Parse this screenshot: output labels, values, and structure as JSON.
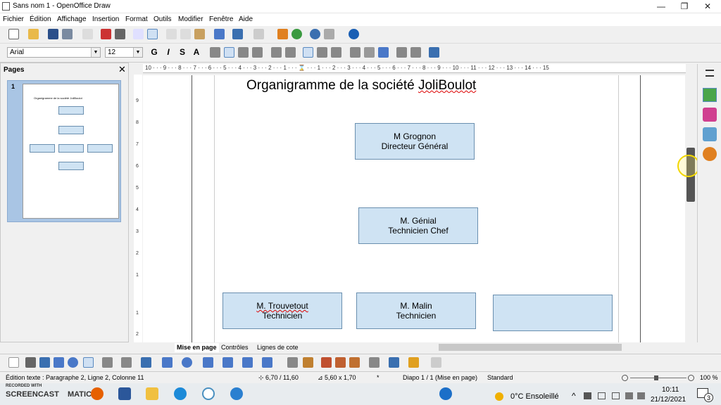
{
  "window": {
    "title": "Sans nom 1 - OpenOffice Draw",
    "minimize": "—",
    "restore": "❐",
    "close": "✕"
  },
  "menu": [
    "Fichier",
    "Édition",
    "Affichage",
    "Insertion",
    "Format",
    "Outils",
    "Modifier",
    "Fenêtre",
    "Aide"
  ],
  "format_bar": {
    "font_name": "Arial",
    "font_size": "12",
    "bold": "G",
    "italic": "I",
    "shadow": "S",
    "outline": "A"
  },
  "pages_panel": {
    "title": "Pages",
    "close": "✕",
    "page_number": "1",
    "thumb_title": "Organigramme de la société JoliBoulot"
  },
  "ruler_h": "10 · · · 9 · · · 8 · · · 7 · · · 6 · · · 5 · · · 4 · · · 3 · · · 2 · · · 1 · · · ⌛ · · · 1 · · · 2 · · · 3 · · · 4 · · · 5 · · · 6 · · · 7 · · · 8 · · · 9 · · · 10 · · · 11 · · · 12 · · · 13 · · · 14 · · · 15",
  "ruler_v": [
    "9",
    "8",
    "7",
    "6",
    "5",
    "4",
    "3",
    "2",
    "1",
    "1",
    "2"
  ],
  "document": {
    "title_pre": "Organigramme de la société ",
    "title_squiggle": "JoliBoulot",
    "boxes": [
      {
        "name": "M Grognon",
        "role": "Directeur Général"
      },
      {
        "name": "M. Génial",
        "role": "Technicien Chef"
      },
      {
        "name": "M. Trouvetout",
        "role": "Technicien"
      },
      {
        "name": "M. Malin",
        "role": "Technicien"
      },
      {
        "name": "",
        "role": ""
      }
    ]
  },
  "tabs": [
    "Mise en page",
    "Contrôles",
    "Lignes de cote"
  ],
  "status": {
    "edit_text": "Édition texte : Paragraphe 2, Ligne 2, Colonne 11",
    "position": "6,70 / 11,60",
    "size": "5,60 x 1,70",
    "modified": "*",
    "slide": "Diapo 1 / 1 (Mise en page)",
    "style": "Standard",
    "zoom": "100 %"
  },
  "taskbar": {
    "recorded_with": "RECORDED WITH",
    "screencast": "SCREENCAST",
    "matic": "MATIC",
    "weather": "0°C  Ensoleillé",
    "time": "10:11",
    "date": "21/12/2021",
    "notifications": "3"
  },
  "colors": {
    "box_fill": "#cfe3f3",
    "box_border": "#6a8faf",
    "thumb_frame": "#a9c5e4"
  }
}
